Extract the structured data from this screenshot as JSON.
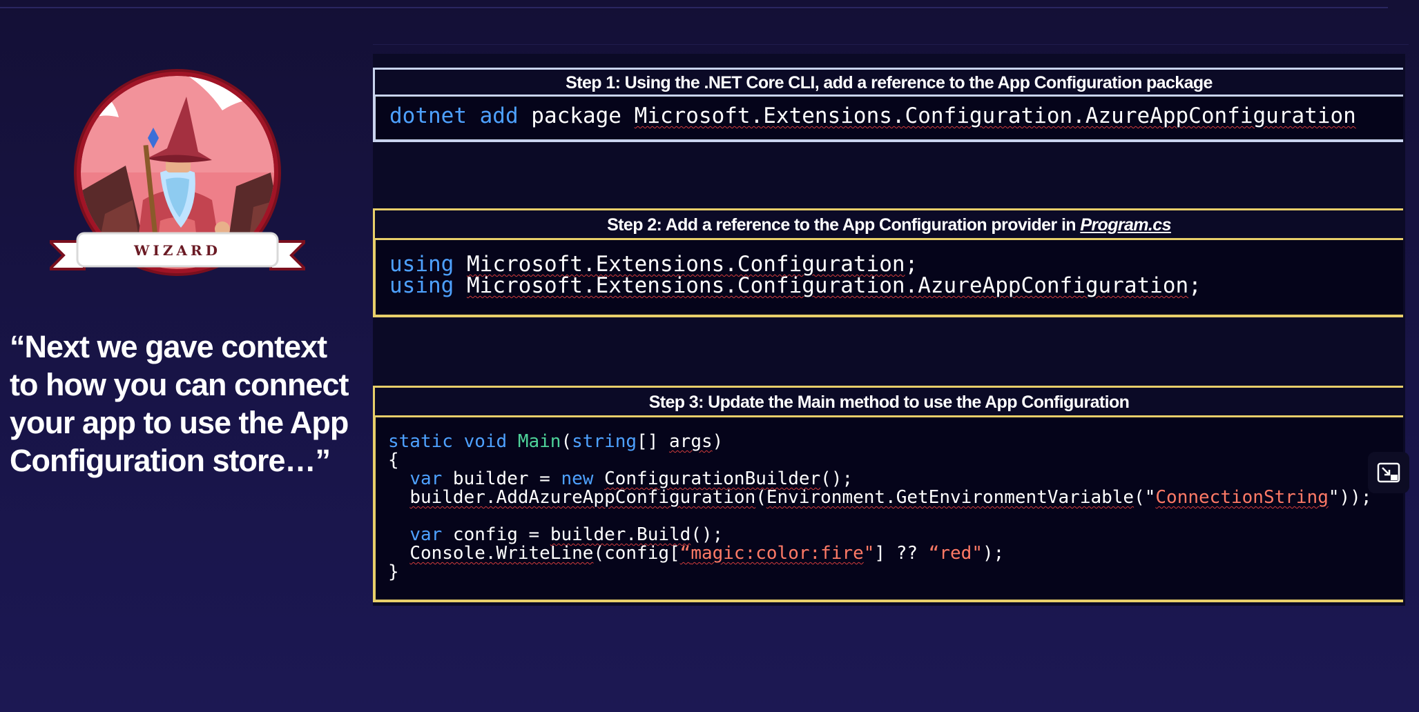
{
  "badge": {
    "label": "WIZARD"
  },
  "quote": "“Next we gave context to how you can connect your app to use the App Configuration store…”",
  "steps": [
    {
      "header_prefix": "Step 1: Using  the .NET Core CLI, add a reference to the App Configuration package",
      "code_lines": [
        {
          "kw1": "dotnet add",
          "rest": " package ",
          "pkg": "Microsoft.Extensions.Configuration.AzureAppConfiguration"
        }
      ]
    },
    {
      "header_prefix": "Step 2: Add a reference to the App Configuration provider in ",
      "header_em": "Program.cs",
      "code_lines": [
        {
          "kw": "using",
          "ns": "Microsoft.Extensions.Configuration",
          "end": ";"
        },
        {
          "kw": "using",
          "ns": "Microsoft.Extensions.Configuration.AzureAppConfiguration",
          "end": ";"
        }
      ]
    },
    {
      "header_prefix": "Step 3: Update the Main method to use the App Configuration",
      "code": {
        "l1_kw": "static void",
        "l1_fn": "Main",
        "l1_paren": "(",
        "l1_type": "string",
        "l1_arr": "[] ",
        "l1_arg": "args",
        "l1_close": ")",
        "l2": "{",
        "l3_var": "var",
        "l3_mid": " builder = ",
        "l3_new": "new",
        "l3_cls": "ConfigurationBuilder",
        "l3_end": "();",
        "l4_call": "builder.AddAzureAppConfiguration",
        "l4_open": "(",
        "l4_env": "Environment.GetEnvironmentVariable",
        "l4_q1": "(\"",
        "l4_str": "ConnectionString",
        "l4_end": "\"));",
        "l6_var": "var",
        "l6_mid": " config = ",
        "l6_build": "builder.Build",
        "l6_end": "();",
        "l7_call": "Console.WriteLine",
        "l7_mid": "(config[",
        "l7_q": "“",
        "l7_str": "magic:color:fire",
        "l7_q2": "\"",
        "l7_mid2": "] ?? ",
        "l7_red": "“red\"",
        "l7_end": ");",
        "l8": "}"
      }
    }
  ],
  "colors": {
    "background": "#181447",
    "keyword": "#4ea1ff",
    "function": "#4ed39a",
    "string": "#ff7a66",
    "step1_border": "#c9d4ee",
    "step2_border": "#e8cf6a"
  },
  "icons": {
    "corner": "exit-fullscreen-icon"
  }
}
